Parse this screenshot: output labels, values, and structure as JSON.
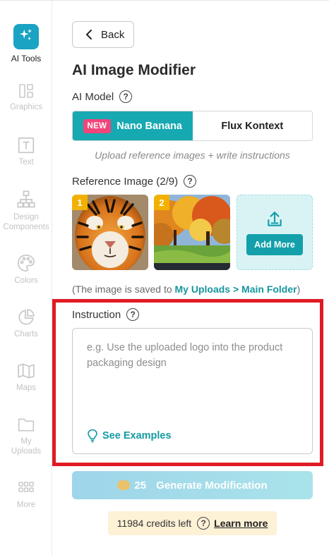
{
  "rail": {
    "items": [
      {
        "label": "AI Tools",
        "icon": "sparkles-icon",
        "active": true
      },
      {
        "label": "Graphics",
        "icon": "shapes-icon"
      },
      {
        "label": "Text",
        "icon": "text-box-icon"
      },
      {
        "label": "Design\nComponents",
        "icon": "hierarchy-icon"
      },
      {
        "label": "Colors",
        "icon": "palette-icon"
      },
      {
        "label": "Charts",
        "icon": "pie-chart-icon"
      },
      {
        "label": "Maps",
        "icon": "map-icon"
      },
      {
        "label": "My\nUploads",
        "icon": "folder-icon"
      },
      {
        "label": "More",
        "icon": "grid-icon"
      }
    ]
  },
  "panel": {
    "back_label": "Back",
    "title": "AI Image Modifier",
    "ai_model_label": "AI Model",
    "model_options": [
      {
        "badge": "NEW",
        "label": "Nano Banana",
        "selected": true
      },
      {
        "label": "Flux Kontext",
        "selected": false
      }
    ],
    "hint": "Upload reference images + write instructions",
    "reference_label": "Reference Image (2/9)",
    "thumbnails": [
      {
        "number": "1",
        "alt": "tiger"
      },
      {
        "number": "2",
        "alt": "autumn park"
      }
    ],
    "add_more_label": "Add More",
    "saved_note_prefix": "(The image is saved to ",
    "saved_note_link": "My Uploads > Main Folder",
    "saved_note_suffix": ")",
    "instruction_label": "Instruction",
    "instruction_placeholder": "e.g. Use the uploaded logo into the product packaging design",
    "see_examples_label": "See Examples",
    "generate": {
      "cost": "25",
      "label": "Generate Modification"
    },
    "credits_text": "11984 credits left",
    "learn_more_label": "Learn more"
  },
  "colors": {
    "accent": "#17a9b2",
    "badge": "#f0457a",
    "highlight_frame": "#e01b24"
  }
}
